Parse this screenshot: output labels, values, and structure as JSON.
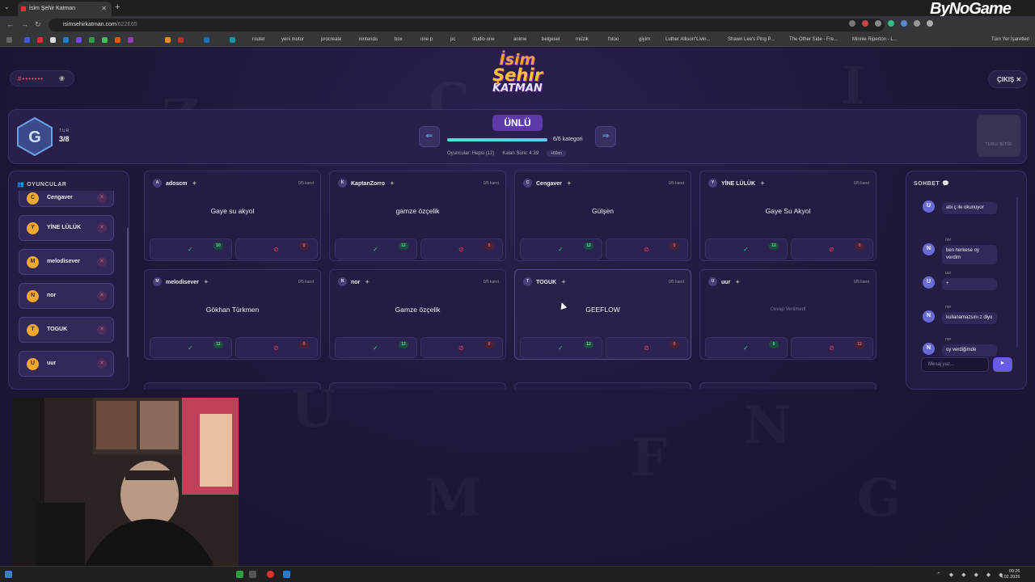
{
  "browser": {
    "tab_title": "İsim Şehir Katman",
    "url_host": "isimsehirkatman.com",
    "url_path": "/622E65",
    "watermark": "ByNoGame",
    "bookmarks": [
      "router",
      "yeni motor",
      "procreate",
      "nintendo",
      "box",
      "one p",
      "pc",
      "studio one",
      "anime",
      "belgesel",
      "müzik",
      "fotoo",
      "giyim",
      "Luther Allison\"Livin...",
      "Shawn Lee's Ping P...",
      "The Other Side - Fre...",
      "Minnie Riperton - L...",
      "Tüm Yer İşaretleri"
    ]
  },
  "game": {
    "room_code": "#•••••••",
    "logo": {
      "line1": "İsim",
      "line2": "Şehir",
      "line3": "KATMAN"
    },
    "exit_label": "ÇIKIŞ ✕",
    "round_letter": "G",
    "round_label": "TUR",
    "round_value": "3/8",
    "category": "ÜNLÜ",
    "prev_arrow": "⇐",
    "next_arrow": "⇒",
    "progress_fraction": 1.0,
    "progress_text": "6/6 kategori",
    "players_info": "Oyuncular: Hepsi (12)",
    "time_left": "Kalan Süre: 4:39",
    "bonus_chip": "+60sn",
    "finish_label": "TURU BİTİR"
  },
  "players": {
    "title": "OYUNCULAR",
    "items": [
      {
        "initial": "C",
        "name": "Cengaver",
        "kick": "✕"
      },
      {
        "initial": "Y",
        "name": "YİNE LÜLÜK",
        "kick": "✕"
      },
      {
        "initial": "M",
        "name": "melodisever",
        "kick": "✕"
      },
      {
        "initial": "N",
        "name": "nor",
        "kick": "✕"
      },
      {
        "initial": "T",
        "name": "TOGUK",
        "kick": "✕"
      },
      {
        "initial": "U",
        "name": "uur",
        "kick": "✕"
      }
    ]
  },
  "answers": [
    {
      "initial": "A",
      "name": "adoscm",
      "votes": "0/5 kanıt",
      "answer": "Gaye su akyol",
      "ok": "10",
      "no": "0"
    },
    {
      "initial": "K",
      "name": "KaptanZorro",
      "votes": "0/5 kanıt",
      "answer": "gamze özçelik",
      "ok": "12",
      "no": "0"
    },
    {
      "initial": "C",
      "name": "Cengaver",
      "votes": "0/5 kanıt",
      "answer": "Gülşen",
      "ok": "12",
      "no": "0"
    },
    {
      "initial": "Y",
      "name": "YİNE LÜLÜK",
      "votes": "0/5 kanıt",
      "answer": "Gaye Su Akyol",
      "ok": "12",
      "no": "0"
    },
    {
      "initial": "M",
      "name": "melodisever",
      "votes": "0/5 kanıt",
      "answer": "Gökhan Türkmen",
      "ok": "11",
      "no": "0"
    },
    {
      "initial": "N",
      "name": "nor",
      "votes": "0/5 kanıt",
      "answer": "Gamze özçelik",
      "ok": "12",
      "no": "0"
    },
    {
      "initial": "T",
      "name": "TOGUK",
      "votes": "0/5 kanıt",
      "answer": "GEEFLOW",
      "ok": "12",
      "no": "0"
    },
    {
      "initial": "U",
      "name": "uur",
      "votes": "0/5 kanıt",
      "answer": "Cevap Verilmedi",
      "ok": "0",
      "no": "12"
    }
  ],
  "chat": {
    "title": "SOHBET",
    "messages": [
      {
        "initial": "U",
        "who": "",
        "text": "abi ç ile okunuyor"
      },
      {
        "initial": "N",
        "who": "nor",
        "text": "ben herkese oy verdim"
      },
      {
        "initial": "U",
        "who": "uur",
        "text": "+"
      },
      {
        "initial": "N",
        "who": "nor",
        "text": "kullanamazsını z diyo"
      },
      {
        "initial": "N",
        "who": "nor",
        "text": "oy verdiğimde"
      }
    ],
    "placeholder": "Mesaj yaz...",
    "send": "►"
  },
  "taskbar": {
    "time": "00:26",
    "date": "4.02.2026"
  },
  "colors": {
    "accent": "#5c3aa8",
    "ok": "#2fd08a",
    "no": "#e5405a",
    "avatar": "#f0a82e"
  }
}
